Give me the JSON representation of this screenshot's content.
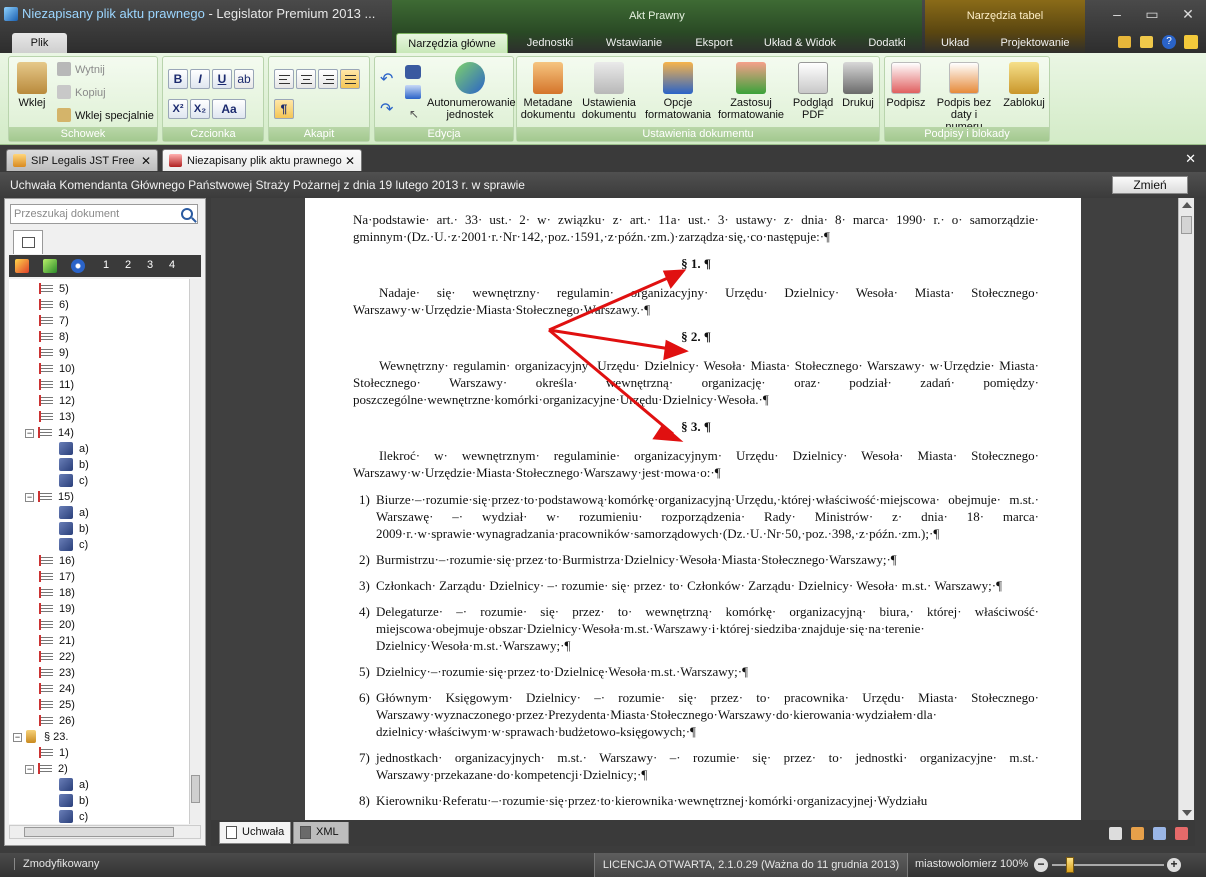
{
  "window": {
    "title_doc": "Niezapisany plik aktu prawnego",
    "title_app": " - Legislator Premium 2013 ...",
    "context_akt": "Akt Prawny",
    "context_tabele": "Narzędzia tabel"
  },
  "ribbon_tabs": [
    "Plik",
    "Narzędzia główne",
    "Jednostki",
    "Wstawianie",
    "Eksport",
    "Układ & Widok",
    "Dodatki",
    "Układ",
    "Projektowanie"
  ],
  "ribbon": {
    "schowek": {
      "label": "Schowek",
      "wklej": "Wklej",
      "wytnij": "Wytnij",
      "kopiuj": "Kopiuj",
      "wklej_specjalnie": "Wklej specjalnie"
    },
    "czcionka": {
      "label": "Czcionka",
      "bold": "B",
      "italic": "I",
      "underline": "U",
      "sup": "X²",
      "sub": "X₂",
      "aa": "Aa"
    },
    "akapit": {
      "label": "Akapit",
      "pilcrow": "¶"
    },
    "edycja": {
      "label": "Edycja",
      "autonumer": "Autonumerowanie jednostek"
    },
    "ustawienia": {
      "label": "Ustawienia dokumentu",
      "metadane": "Metadane dokumentu",
      "ustawienia": "Ustawienia dokumentu",
      "opcje": "Opcje formatowania",
      "zastosuj": "Zastosuj formatowanie",
      "podglad": "Podgląd PDF",
      "drukuj": "Drukuj"
    },
    "podpisy": {
      "label": "Podpisy i blokady",
      "podpisz": "Podpisz",
      "podpis_bez": "Podpis bez daty i numeru",
      "zablokuj": "Zablokuj"
    }
  },
  "doc_tabs": [
    "SIP Legalis JST Free",
    "Niezapisany plik aktu prawnego"
  ],
  "header": {
    "title": "Uchwała Komendanta Głównego Państwowej Straży Pożarnej z dnia 19 lutego 2013 r. w sprawie",
    "button": "Zmień"
  },
  "left_panel": {
    "search_placeholder": "Przeszukaj dokument",
    "levels": [
      "1",
      "2",
      "3",
      "4"
    ],
    "tree": [
      {
        "label": "5)",
        "kind": "p",
        "lvl": 1
      },
      {
        "label": "6)",
        "kind": "p",
        "lvl": 1
      },
      {
        "label": "7)",
        "kind": "p",
        "lvl": 1
      },
      {
        "label": "8)",
        "kind": "p",
        "lvl": 1
      },
      {
        "label": "9)",
        "kind": "p",
        "lvl": 1
      },
      {
        "label": "10)",
        "kind": "p",
        "lvl": 1
      },
      {
        "label": "11)",
        "kind": "p",
        "lvl": 1
      },
      {
        "label": "12)",
        "kind": "p",
        "lvl": 1
      },
      {
        "label": "13)",
        "kind": "p",
        "lvl": 1
      },
      {
        "label": "14)",
        "kind": "p",
        "lvl": 1,
        "exp": true
      },
      {
        "label": "a)",
        "kind": "l",
        "lvl": 2
      },
      {
        "label": "b)",
        "kind": "l",
        "lvl": 2
      },
      {
        "label": "c)",
        "kind": "l",
        "lvl": 2
      },
      {
        "label": "15)",
        "kind": "p",
        "lvl": 1,
        "exp": true
      },
      {
        "label": "a)",
        "kind": "l",
        "lvl": 2
      },
      {
        "label": "b)",
        "kind": "l",
        "lvl": 2
      },
      {
        "label": "c)",
        "kind": "l",
        "lvl": 2
      },
      {
        "label": "16)",
        "kind": "p",
        "lvl": 1
      },
      {
        "label": "17)",
        "kind": "p",
        "lvl": 1
      },
      {
        "label": "18)",
        "kind": "p",
        "lvl": 1
      },
      {
        "label": "19)",
        "kind": "p",
        "lvl": 1
      },
      {
        "label": "20)",
        "kind": "p",
        "lvl": 1
      },
      {
        "label": "21)",
        "kind": "p",
        "lvl": 1
      },
      {
        "label": "22)",
        "kind": "p",
        "lvl": 1
      },
      {
        "label": "23)",
        "kind": "p",
        "lvl": 1
      },
      {
        "label": "24)",
        "kind": "p",
        "lvl": 1
      },
      {
        "label": "25)",
        "kind": "p",
        "lvl": 1
      },
      {
        "label": "26)",
        "kind": "p",
        "lvl": 1
      },
      {
        "label": "§ 23.",
        "kind": "s",
        "lvl": 0,
        "exp": true
      },
      {
        "label": "1)",
        "kind": "p",
        "lvl": 1
      },
      {
        "label": "2)",
        "kind": "p",
        "lvl": 1,
        "exp": true
      },
      {
        "label": "a)",
        "kind": "l",
        "lvl": 2
      },
      {
        "label": "b)",
        "kind": "l",
        "lvl": 2
      },
      {
        "label": "c)",
        "kind": "l",
        "lvl": 2
      }
    ]
  },
  "document": {
    "intro": "Na·podstawie· art.· 33· ust.· 2· w· związku· z· art.· 11a· ust.· 3· ustawy· z· dnia· 8· marca· 1990· r.· o· samorządzie· gminnym·(Dz.·U.·z·2001·r.·Nr·142,·poz.·1591,·z·późn.·zm.)·zarządza·się,·co·następuje:·¶",
    "s1": "§ 1. ¶",
    "p1": "Nadaje· się· wewnętrzny· regulamin· organizacyjny· Urzędu· Dzielnicy· Wesoła· Miasta· Stołecznego· Warszawy·w·Urzędzie·Miasta·Stołecznego·Warszawy.·¶",
    "s2": "§ 2. ¶",
    "p2": "Wewnętrzny· regulamin· organizacyjny· Urzędu· Dzielnicy· Wesoła· Miasta· Stołecznego· Warszawy· w·Urzędzie· Miasta· Stołecznego· Warszawy· określa· wewnętrzną· organizację· oraz· podział· zadań· pomiędzy· poszczególne·wewnętrzne·komórki·organizacyjne·Urzędu·Dzielnicy·Wesoła.·¶",
    "s3": "§ 3. ¶",
    "p3": "Ilekroć· w· wewnętrznym· regulaminie· organizacyjnym· Urzędu· Dzielnicy· Wesoła· Miasta· Stołecznego· Warszawy·w·Urzędzie·Miasta·Stołecznego·Warszawy·jest·mowa·o:·¶",
    "items": [
      {
        "num": "1)",
        "text": "Biurze·–·rozumie·się·przez·to·podstawową·komórkę·organizacyjną·Urzędu,·której·właściwość·miejscowa· obejmuje· m.st.· Warszawę· –· wydział· w· rozumieniu· rozporządzenia· Rady· Ministrów· z· dnia· 18· marca· 2009·r.·w·sprawie·wynagradzania·pracowników·samorządowych·(Dz.·U.·Nr·50,·poz.·398,·z·późn.·zm.);·¶"
      },
      {
        "num": "2)",
        "text": "Burmistrzu·–·rozumie·się·przez·to·Burmistrza·Dzielnicy·Wesoła·Miasta·Stołecznego·Warszawy;·¶"
      },
      {
        "num": "3)",
        "text": "Członkach· Zarządu· Dzielnicy· –· rozumie· się· przez· to· Członków· Zarządu· Dzielnicy· Wesoła· m.st.· Warszawy;·¶"
      },
      {
        "num": "4)",
        "text": "Delegaturze· –· rozumie· się· przez· to· wewnętrzną· komórkę· organizacyjną· biura,· której· właściwość· miejscowa·obejmuje·obszar·Dzielnicy·Wesoła·m.st.·Warszawy·i·której·siedziba·znajduje·się·na·terenie· Dzielnicy·Wesoła·m.st.·Warszawy;·¶"
      },
      {
        "num": "5)",
        "text": "Dzielnicy·–·rozumie·się·przez·to·Dzielnicę·Wesoła·m.st.·Warszawy;·¶"
      },
      {
        "num": "6)",
        "text": "Głównym· Księgowym· Dzielnicy· –· rozumie· się· przez· to· pracownika· Urzędu· Miasta· Stołecznego· Warszawy·wyznaczonego·przez·Prezydenta·Miasta·Stołecznego·Warszawy·do·kierowania·wydziałem·dla· dzielnicy·właściwym·w·sprawach·budżetowo-księgowych;·¶"
      },
      {
        "num": "7)",
        "text": "jednostkach· organizacyjnych· m.st.· Warszawy· –· rozumie· się· przez· to· jednostki· organizacyjne· m.st.· Warszawy·przekazane·do·kompetencji·Dzielnicy;·¶"
      },
      {
        "num": "8)",
        "text": "Kierowniku·Referatu·–·rozumie·się·przez·to·kierownika·wewnętrznej·komórki·organizacyjnej·Wydziału"
      }
    ]
  },
  "view_tabs": [
    "Uchwała",
    "XML"
  ],
  "status": {
    "modified": "Zmodyfikowany",
    "license": "LICENCJA OTWARTA, 2.1.0.29 (Ważna do 11 grudnia 2013)",
    "user": "miastowolomierz",
    "zoom": "100%"
  },
  "colors": {
    "accent_green": "#c8e8b8",
    "arrow_red": "#e01010",
    "title_blue": "#9cd6ff"
  }
}
